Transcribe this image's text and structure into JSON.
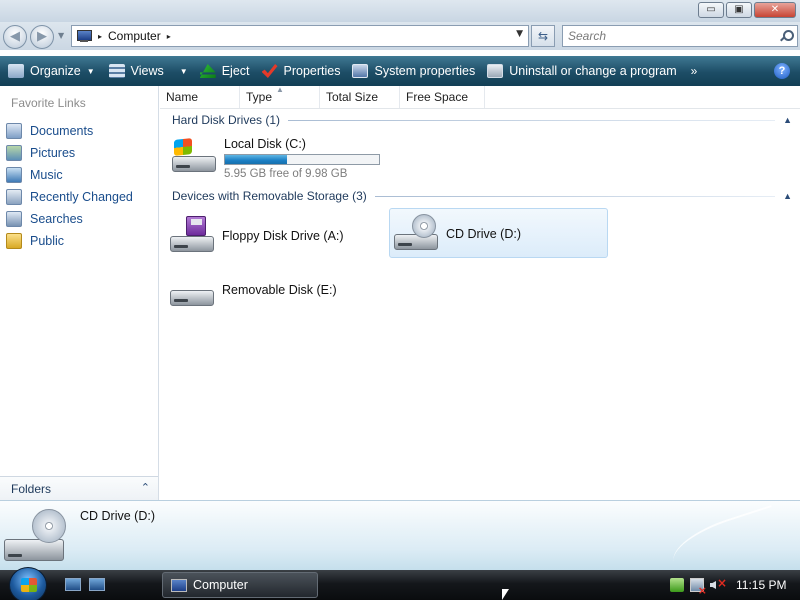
{
  "window": {
    "controls": {
      "minimize": "▭",
      "maximize": "▣",
      "close": "✕"
    }
  },
  "address_bar": {
    "back_icon": "back-arrow-icon",
    "forward_icon": "forward-arrow-icon",
    "location": "Computer",
    "separator": "▸",
    "search_placeholder": "Search"
  },
  "command_bar": {
    "items": [
      {
        "label": "Organize",
        "icon": "organize-icon",
        "dropdown": true
      },
      {
        "label": "Views",
        "icon": "views-icon",
        "dropdown": true
      },
      {
        "label": "Eject",
        "icon": "eject-icon",
        "dropdown": false
      },
      {
        "label": "Properties",
        "icon": "properties-icon",
        "dropdown": false
      },
      {
        "label": "System properties",
        "icon": "system-properties-icon",
        "dropdown": false
      },
      {
        "label": "Uninstall or change a program",
        "icon": "uninstall-icon",
        "dropdown": false
      }
    ],
    "more": "»",
    "help": "?"
  },
  "nav_pane": {
    "title": "Favorite Links",
    "links": [
      {
        "label": "Documents",
        "icon": "documents-icon"
      },
      {
        "label": "Pictures",
        "icon": "pictures-icon"
      },
      {
        "label": "Music",
        "icon": "music-icon"
      },
      {
        "label": "Recently Changed",
        "icon": "recently-changed-icon"
      },
      {
        "label": "Searches",
        "icon": "searches-icon"
      },
      {
        "label": "Public",
        "icon": "public-folder-icon"
      }
    ],
    "folders_label": "Folders",
    "folders_chevron": "⌃"
  },
  "columns": [
    "Name",
    "Type",
    "Total Size",
    "Free Space"
  ],
  "groups": {
    "hard_disk": {
      "label": "Hard Disk Drives (1)",
      "drives": [
        {
          "name": "Local Disk (C:)",
          "free_text": "5.95 GB free of 9.98 GB",
          "used_fraction": 0.404,
          "icon": "hard-disk-icon"
        }
      ]
    },
    "removable": {
      "label": "Devices with Removable Storage (3)",
      "drives": [
        {
          "name": "Floppy Disk Drive (A:)",
          "icon": "floppy-drive-icon"
        },
        {
          "name": "CD Drive (D:)",
          "icon": "cd-drive-icon",
          "selected": true
        },
        {
          "name": "Removable Disk (E:)",
          "icon": "removable-disk-icon"
        }
      ]
    }
  },
  "details_pane": {
    "name": "CD Drive (D:)",
    "icon": "cd-drive-icon"
  },
  "taskbar": {
    "start_icon": "start-orb-icon",
    "task_button": "Computer",
    "clock": "11:15 PM"
  },
  "colors": {
    "command_bar": "#1d4d66",
    "link": "#1a4d8c",
    "capacity_fill": "#1b7fc4",
    "selection": "#dcecfa"
  }
}
